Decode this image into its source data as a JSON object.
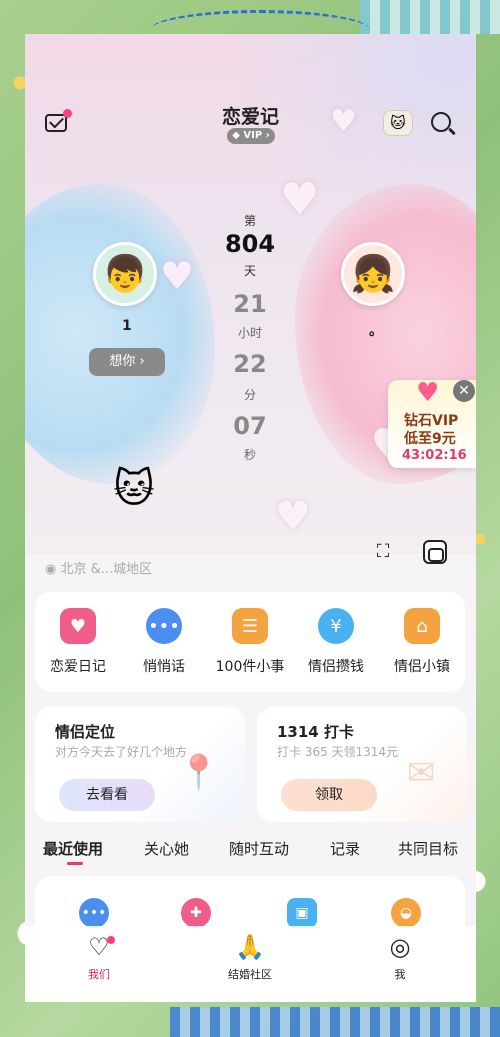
{
  "header": {
    "title": "恋爱记",
    "vip_label": "VIP",
    "mail_icon": "mail-icon",
    "search_icon": "search-icon"
  },
  "couple": {
    "left_name": "1",
    "right_name": "。",
    "miss_button": "想你"
  },
  "counter": {
    "prefix": "第",
    "days": "804",
    "days_unit": "天",
    "hours": "21",
    "hours_unit": "小时",
    "minutes": "22",
    "minutes_unit": "分",
    "seconds": "07",
    "seconds_unit": "秒"
  },
  "location": "北京 &...城地区",
  "promo": {
    "line1": "钻石VIP",
    "line2": "低至9元",
    "timer": "43:02:16"
  },
  "features": [
    {
      "label": "恋爱日记",
      "icon": "diary-icon",
      "color": "#f05d8b"
    },
    {
      "label": "悄悄话",
      "icon": "chat-icon",
      "color": "#4a8ef0"
    },
    {
      "label": "100件小事",
      "icon": "list-icon",
      "color": "#f5a340"
    },
    {
      "label": "情侣攒钱",
      "icon": "piggy-bank-icon",
      "color": "#4ab1f0"
    },
    {
      "label": "情侣小镇",
      "icon": "house-icon",
      "color": "#f5a340"
    }
  ],
  "cards": {
    "left": {
      "title": "情侣定位",
      "sub": "对方今天去了好几个地方",
      "button": "去看看"
    },
    "right": {
      "title": "1314 打卡",
      "sub": "打卡 365 天领1314元",
      "button": "领取"
    }
  },
  "tabs": [
    "最近使用",
    "关心她",
    "随时互动",
    "记录",
    "共同目标"
  ],
  "bottom_nav": [
    {
      "label": "我们",
      "icon": "heart-icon"
    },
    {
      "label": "结婚社区",
      "icon": "hands-icon"
    },
    {
      "label": "我",
      "icon": "profile-icon"
    }
  ],
  "colors": {
    "accent": "#e23a6b",
    "nav_active": "#d3215f"
  }
}
